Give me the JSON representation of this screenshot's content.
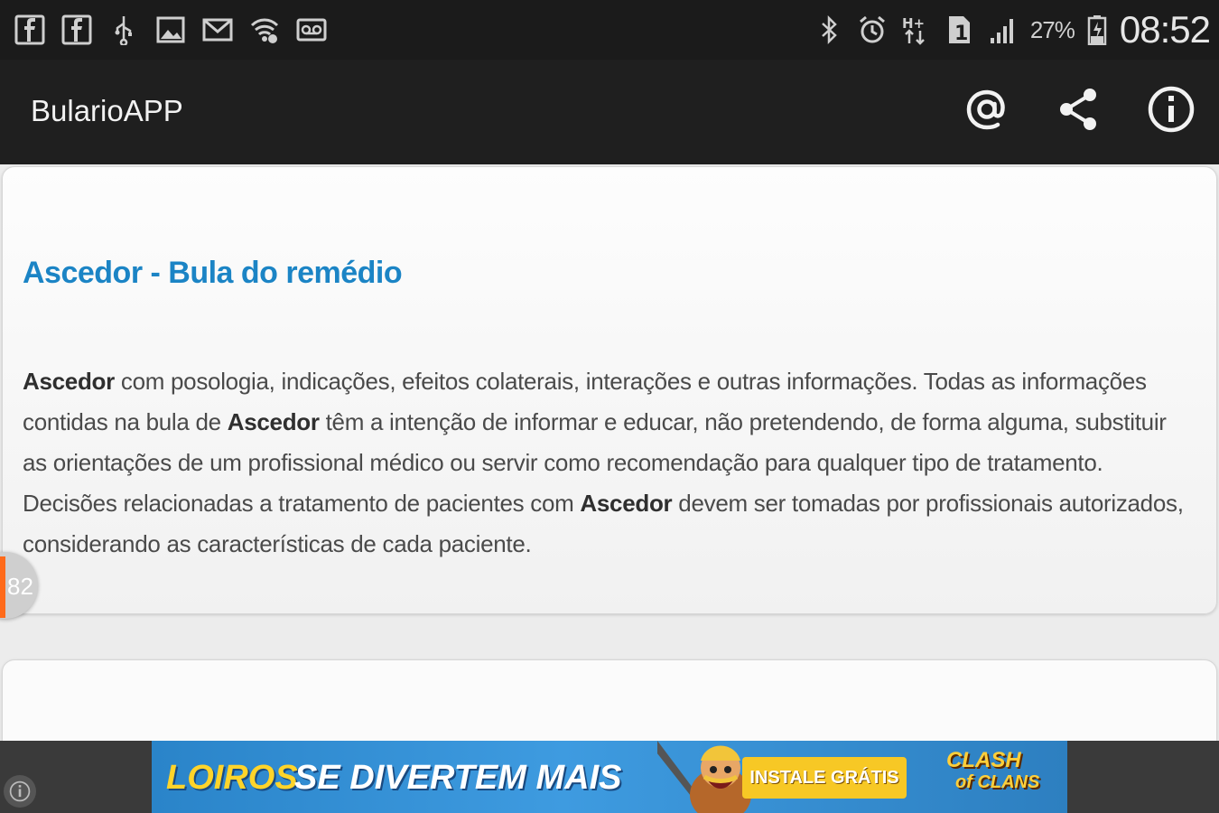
{
  "status_bar": {
    "left_icons": [
      "facebook-icon",
      "facebook-icon",
      "usb-icon",
      "image-icon",
      "gmail-icon",
      "wifi-icon",
      "voicemail-icon"
    ],
    "right_icons": [
      "bluetooth-icon",
      "alarm-icon",
      "data-transfer-icon",
      "sim-icon",
      "signal-icon",
      "battery-icon"
    ],
    "battery_percent": "27%",
    "time": "08:52"
  },
  "app_bar": {
    "title": "BularioAPP",
    "actions": [
      "at-icon",
      "share-icon",
      "info-icon"
    ]
  },
  "card": {
    "title": "Ascedor - Bula do remédio",
    "body": [
      {
        "text": "Ascedor",
        "bold": true
      },
      {
        "text": " com posologia, indicações, efeitos colaterais, interações e outras informações. Todas as informações contidas na bula de ",
        "bold": false
      },
      {
        "text": "Ascedor",
        "bold": true
      },
      {
        "text": " têm a intenção de informar e educar, não pretendendo, de forma alguma, substituir as orientações de um profissional médico ou servir como recomendação para qualquer tipo de tratamento. Decisões relacionadas a tratamento de pacientes com ",
        "bold": false
      },
      {
        "text": "Ascedor",
        "bold": true
      },
      {
        "text": " devem ser tomadas por profissionais autorizados, considerando as características de cada paciente.",
        "bold": false
      }
    ]
  },
  "floating_badge": {
    "number": "82"
  },
  "ad": {
    "headline_part1": "LOIROS",
    "headline_part2": "SE DIVERTEM MAIS",
    "cta": "INSTALE GRÁTIS",
    "logo_line1": "CLASH",
    "logo_line2": "of CLANS"
  },
  "colors": {
    "status_bar_bg": "#1b1b1b",
    "app_bar_bg": "#1f1f1f",
    "title_blue": "#1b84c5",
    "badge_accent": "#ff6a1a",
    "ad_cta": "#f7c825"
  }
}
